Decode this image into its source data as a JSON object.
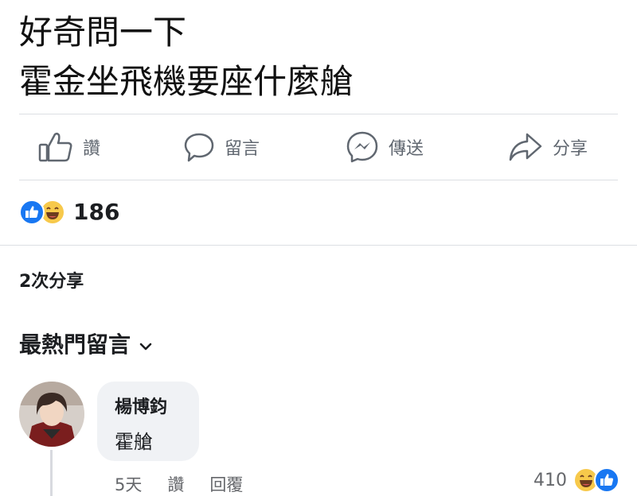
{
  "post": {
    "line1": "好奇問一下",
    "line2": "霍金坐飛機要座什麼艙"
  },
  "actions": {
    "like": "讚",
    "comment": "留言",
    "send": "傳送",
    "share": "分享"
  },
  "reactions": {
    "count": "186",
    "icons": [
      "thumbs-up-icon",
      "laughing-face-icon"
    ]
  },
  "shares": {
    "label": "2次分享"
  },
  "comments": {
    "sort_label": "最熱門留言",
    "items": [
      {
        "author": "楊博鈞",
        "text": "霍艙",
        "time": "5天",
        "like": "讚",
        "reply": "回覆",
        "reaction_count": "410"
      }
    ]
  },
  "colors": {
    "accent": "#1877f2",
    "haha": "#f7c94b",
    "secondary_text": "#65676b"
  }
}
